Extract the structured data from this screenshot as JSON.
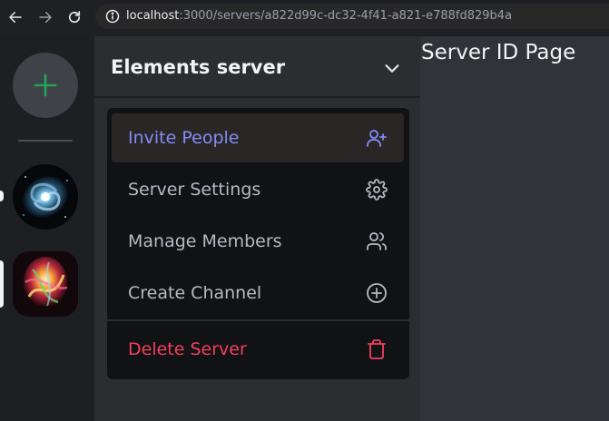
{
  "browser": {
    "url_host": "localhost",
    "url_path": ":3000/servers/a822d99c-dc32-4f41-a821-e788fd829b4a"
  },
  "rail": {
    "servers": [
      {
        "kind": "galaxy"
      },
      {
        "kind": "abstract-flame"
      }
    ],
    "add_color": "#23a55a"
  },
  "server": {
    "name": "Elements server"
  },
  "menu": {
    "items": [
      {
        "label": "Invite People",
        "icon": "user-plus-icon",
        "color": "#818cf8"
      },
      {
        "label": "Server Settings",
        "icon": "gear-icon",
        "color": "#b5bac1"
      },
      {
        "label": "Manage Members",
        "icon": "users-icon",
        "color": "#b5bac1"
      },
      {
        "label": "Create Channel",
        "icon": "plus-circle-icon",
        "color": "#b5bac1"
      },
      {
        "label": "Delete Server",
        "icon": "trash-icon",
        "color": "#f43f5e"
      }
    ]
  },
  "main": {
    "title": "Server ID Page"
  }
}
